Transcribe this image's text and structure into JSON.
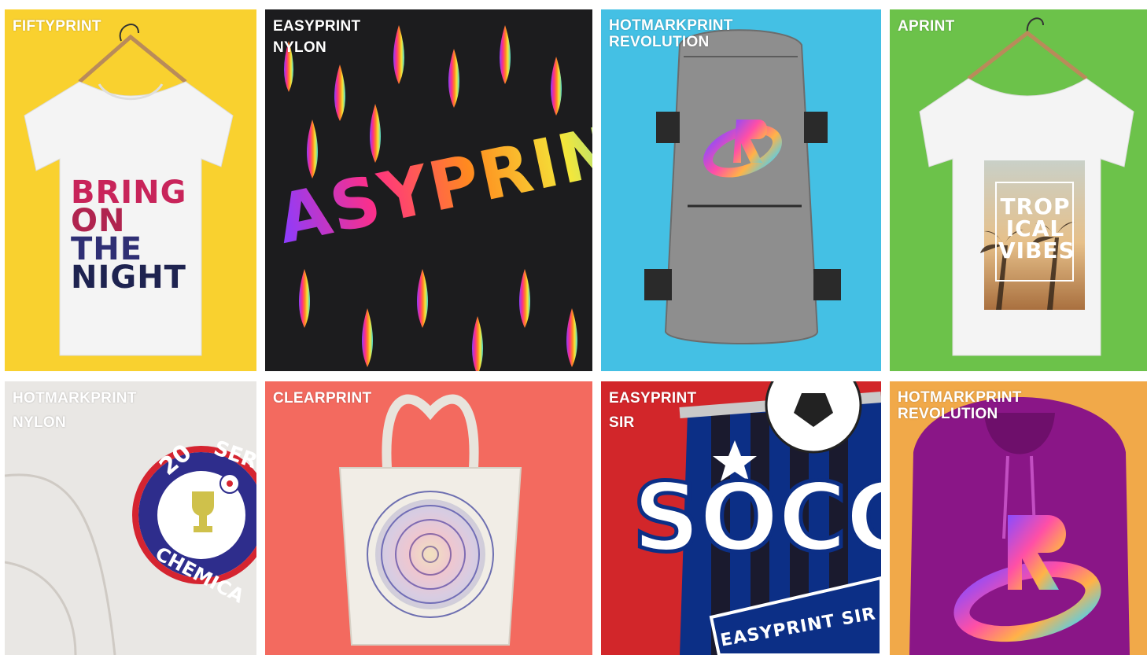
{
  "tiles": [
    {
      "id": "fiftyprint",
      "label_lines": [
        "FIFTYPRINT"
      ],
      "background": "#f9d12f",
      "product": "t-shirt",
      "print_text": [
        "BRING",
        "ON",
        "THE",
        "NIGHT"
      ]
    },
    {
      "id": "easyprint-nylon",
      "label_lines": [
        "EASYPRINT",
        "NYLON"
      ],
      "background": "#1c1c1e",
      "product": "fabric-closeup",
      "print_text": [
        "ASYPRINT"
      ]
    },
    {
      "id": "hotmarkprint-revolution-backpack",
      "label_lines": [
        "HOTMARKPRINT",
        "REVOLUTION"
      ],
      "background": "#44c0e4",
      "product": "backpack",
      "print_text": []
    },
    {
      "id": "aprint",
      "label_lines": [
        "APRINT"
      ],
      "background": "#6cc24a",
      "product": "t-shirt",
      "print_text": [
        "TROP",
        "ICAL",
        "VIBES"
      ]
    },
    {
      "id": "hotmarkprint-nylon",
      "label_lines": [
        "HOTMARKPRINT",
        "NYLON"
      ],
      "background": "#e9e7e4",
      "product": "ball-closeup",
      "print_text": [
        "20",
        "SER",
        "CHEMICA"
      ]
    },
    {
      "id": "clearprint",
      "label_lines": [
        "CLEARPRINT"
      ],
      "background": "#f36a5f",
      "product": "tote-bag",
      "print_text": []
    },
    {
      "id": "easyprint-sir",
      "label_lines": [
        "EASYPRINT",
        "SIR"
      ],
      "background": "#d2262a",
      "product": "soccer-badge",
      "print_text": [
        "SOCC",
        "EASYPRINT SIR"
      ]
    },
    {
      "id": "hotmarkprint-revolution-hoodie",
      "label_lines": [
        "HOTMARKPRINT",
        "REVOLUTION"
      ],
      "background": "#f1a949",
      "product": "hoodie",
      "print_text": []
    }
  ]
}
